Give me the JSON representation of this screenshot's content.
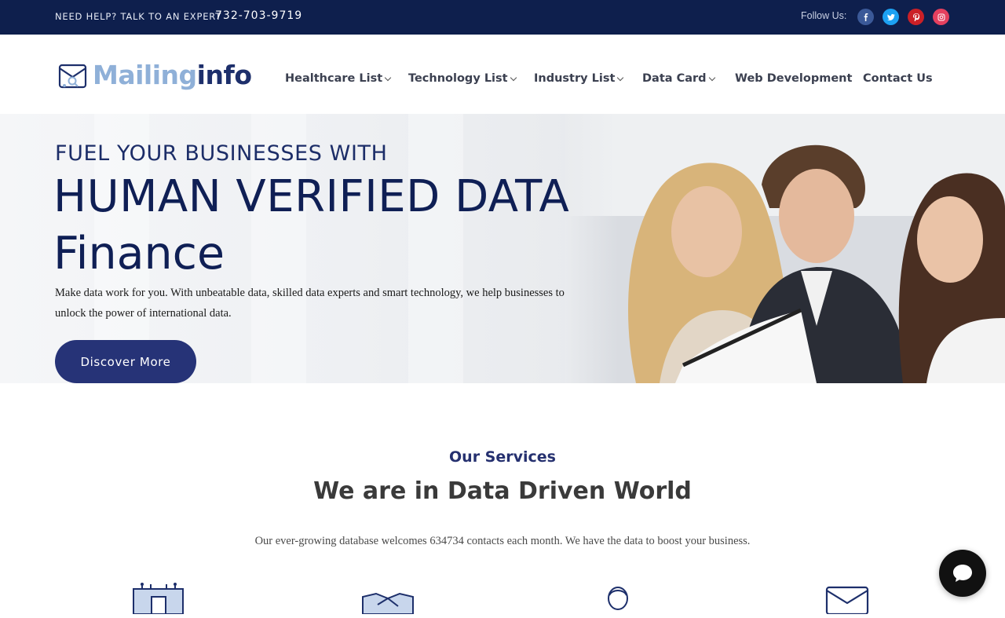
{
  "topbar": {
    "help_text": "NEED HELP? TALK TO AN EXPERT",
    "phone": "732-703-9719",
    "follow_label": "Follow Us:",
    "social": [
      {
        "icon": "facebook-icon",
        "color": "#3b5998"
      },
      {
        "icon": "twitter-icon",
        "color": "#1da1f2"
      },
      {
        "icon": "pinterest-icon",
        "color": "#cb2027"
      },
      {
        "icon": "instagram-icon",
        "color": "#e4405f"
      }
    ]
  },
  "logo": {
    "part1": "Mailing",
    "part2": "info"
  },
  "nav": {
    "items": [
      {
        "label": "Healthcare List",
        "dropdown": true
      },
      {
        "label": "Technology List",
        "dropdown": true
      },
      {
        "label": "Industry List",
        "dropdown": true
      },
      {
        "label": "Data Card",
        "dropdown": true
      },
      {
        "label": "Web Development",
        "dropdown": false
      },
      {
        "label": "Contact Us",
        "dropdown": false
      }
    ]
  },
  "hero": {
    "eyebrow": "FUEL YOUR BUSINESSES WITH",
    "headline": "HUMAN VERIFIED DATA",
    "rotating_word": "Finance",
    "lead": "Make data work for you. With unbeatable data, skilled data experts and smart technology, we help businesses to unlock the power of international data.",
    "cta": "Discover More"
  },
  "services": {
    "tag": "Our Services",
    "title": "We are in Data Driven World",
    "subtitle": "Our ever-growing database welcomes 634734 contacts each month. We have the data to boost your business.",
    "icons": [
      "database-icon",
      "handshake-icon",
      "person-icon",
      "mail-icon"
    ]
  },
  "colors": {
    "navy": "#0e1f4d",
    "accent": "#263377",
    "logo_light": "#8fb0d8"
  },
  "chat": {
    "icon": "chat-bubble-icon"
  }
}
